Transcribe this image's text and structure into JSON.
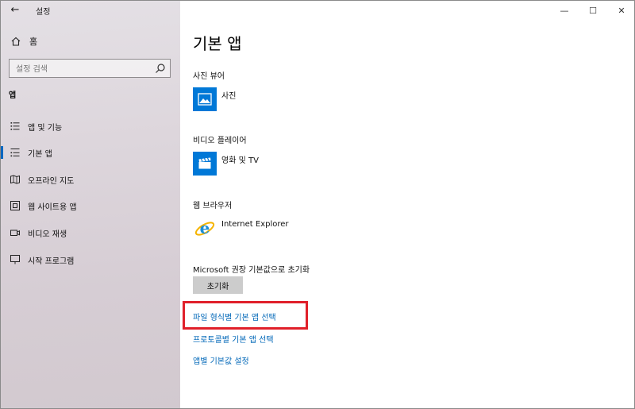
{
  "app": {
    "title": "설정",
    "back_glyph": "←"
  },
  "window_controls": {
    "minimize": "—",
    "maximize": "☐",
    "close": "✕"
  },
  "sidebar": {
    "home_label": "홈",
    "search": {
      "placeholder": "설정 검색",
      "value": ""
    },
    "section_label": "앱",
    "items": [
      {
        "label": "앱 및 기능",
        "icon": "list-icon",
        "selected": false
      },
      {
        "label": "기본 앱",
        "icon": "default-apps-icon",
        "selected": true
      },
      {
        "label": "오프라인 지도",
        "icon": "map-icon",
        "selected": false
      },
      {
        "label": "웹 사이트용 앱",
        "icon": "website-icon",
        "selected": false
      },
      {
        "label": "비디오 재생",
        "icon": "video-icon",
        "selected": false
      },
      {
        "label": "시작 프로그램",
        "icon": "startup-icon",
        "selected": false
      }
    ]
  },
  "main": {
    "title": "기본 앱",
    "groups": [
      {
        "label": "사진 뷰어",
        "app_name": "사진",
        "icon": "photos-app-icon"
      },
      {
        "label": "비디오 플레이어",
        "app_name": "영화 및 TV",
        "icon": "movies-tv-app-icon"
      },
      {
        "label": "웹 브라우저",
        "app_name": "Internet Explorer",
        "icon": "internet-explorer-icon"
      }
    ],
    "reset": {
      "label": "Microsoft 권장 기본값으로 초기화",
      "button": "초기화"
    },
    "links": [
      "파일 형식별 기본 앱 선택",
      "프로토콜별 기본 앱 선택",
      "앱별 기본값 설정"
    ]
  },
  "colors": {
    "accent": "#0067c0",
    "link": "#0067b8",
    "highlight": "#e0202a",
    "tile": "#0078d7"
  }
}
